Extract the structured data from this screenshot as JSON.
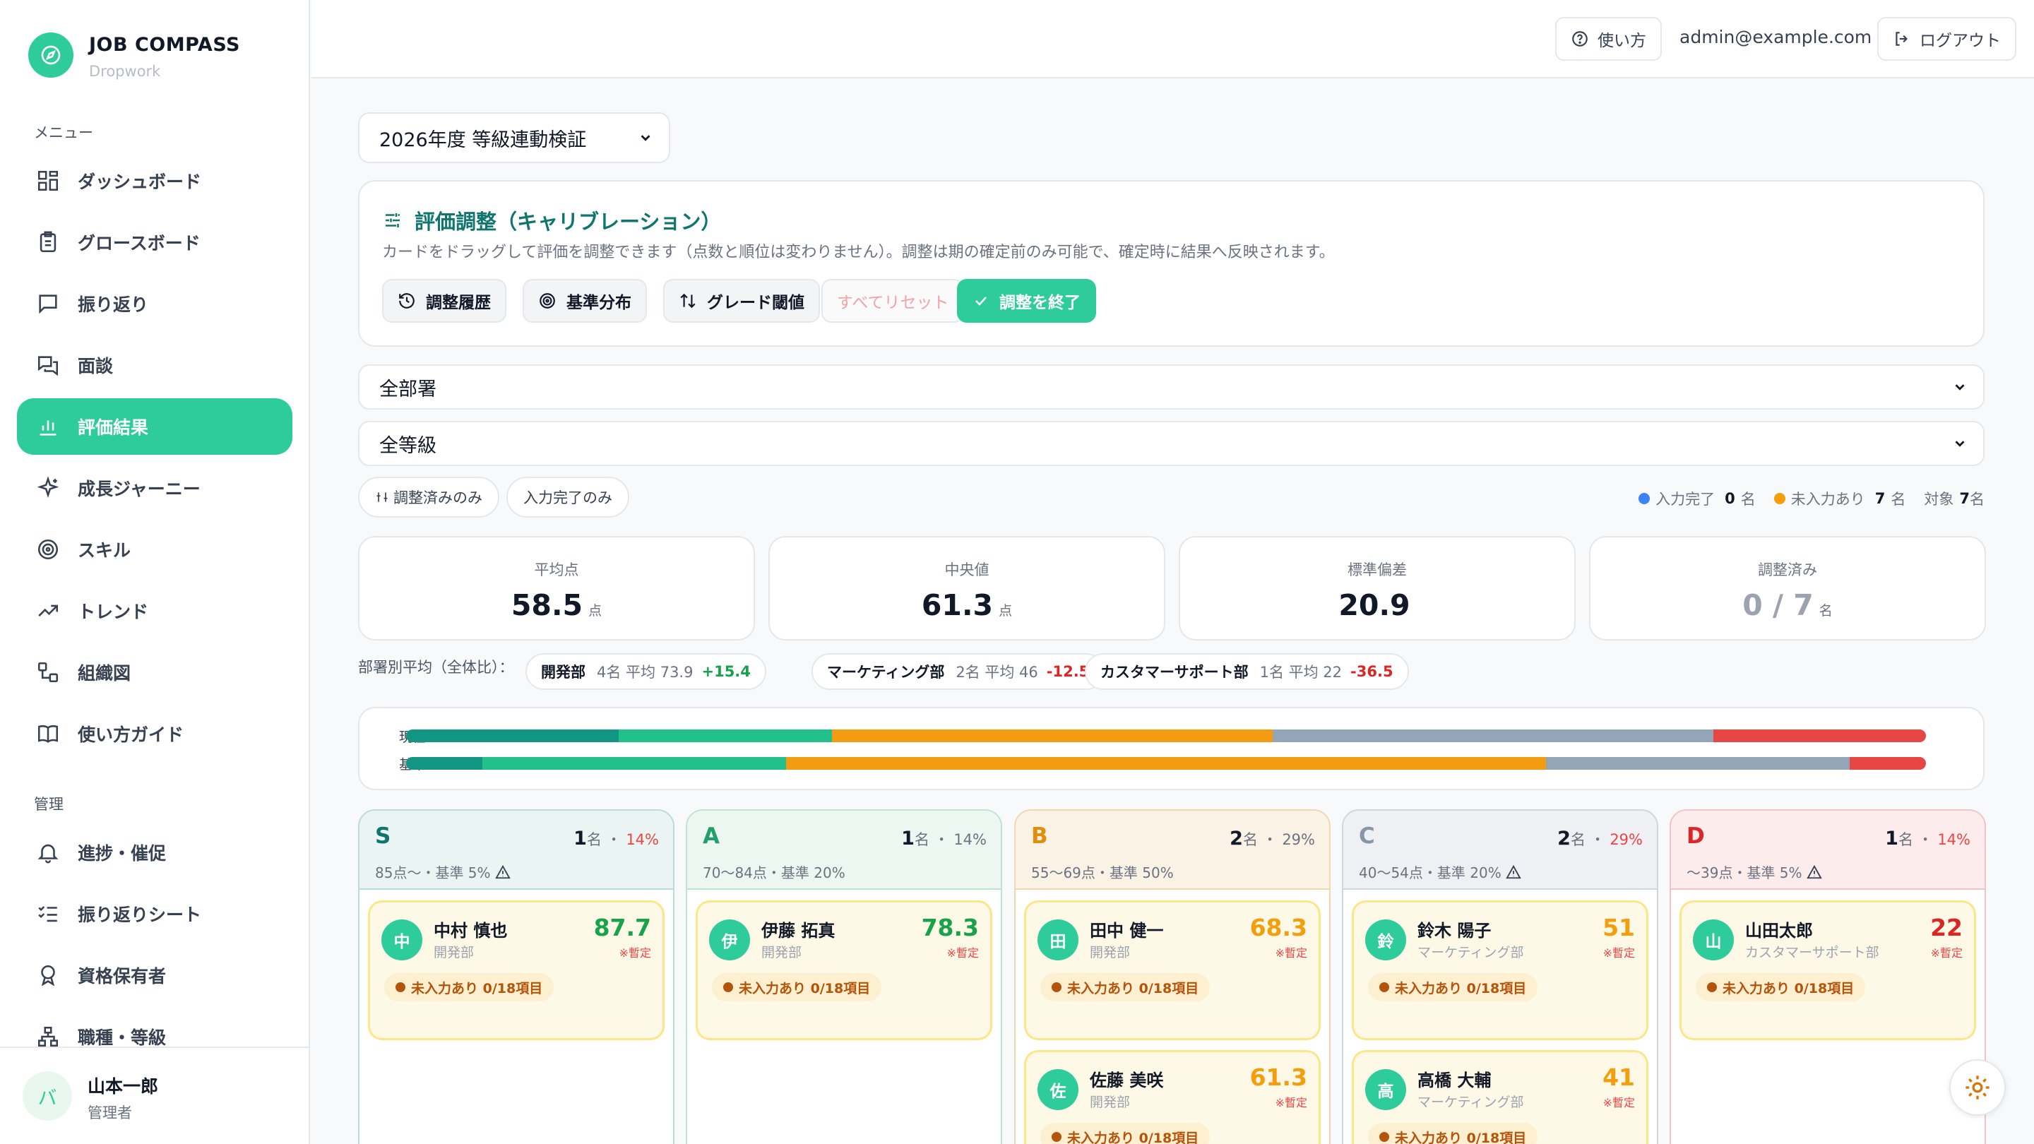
{
  "brand": {
    "title": "JOB COMPASS",
    "subtitle": "Dropwork"
  },
  "sidebar": {
    "menu_label": "メニュー",
    "admin_label": "管理",
    "items": [
      {
        "label": "ダッシュボード",
        "icon": "dashboard-icon"
      },
      {
        "label": "グロースボード",
        "icon": "clipboard-icon"
      },
      {
        "label": "振り返り",
        "icon": "message-icon"
      },
      {
        "label": "面談",
        "icon": "chat-icon"
      },
      {
        "label": "評価結果",
        "icon": "bar-chart-icon",
        "active": true
      },
      {
        "label": "成長ジャーニー",
        "icon": "sparkle-icon"
      },
      {
        "label": "スキル",
        "icon": "target-icon"
      },
      {
        "label": "トレンド",
        "icon": "trend-icon"
      },
      {
        "label": "組織図",
        "icon": "org-icon"
      },
      {
        "label": "使い方ガイド",
        "icon": "book-icon"
      }
    ],
    "admin_items": [
      {
        "label": "進捗・催促",
        "icon": "bell-icon"
      },
      {
        "label": "振り返りシート",
        "icon": "checklist-icon"
      },
      {
        "label": "資格保有者",
        "icon": "award-icon"
      },
      {
        "label": "職種・等級",
        "icon": "hierarchy-icon"
      }
    ],
    "user": {
      "initial": "バ",
      "name": "山本一郎",
      "role": "管理者"
    }
  },
  "header": {
    "help": "使い方",
    "email": "admin@example.com",
    "logout": "ログアウト"
  },
  "period_select": "2026年度 等級連動検証",
  "calibration": {
    "title": "評価調整（キャリブレーション）",
    "desc": "カードをドラッグして評価を調整できます（点数と順位は変わりません）。調整は期の確定前のみ可能で、確定時に結果へ反映されます。",
    "buttons": {
      "history": "調整履歴",
      "baseline": "基準分布",
      "threshold": "グレード閾値",
      "reset": "すべてリセット",
      "finish": "調整を終了"
    }
  },
  "filters": {
    "dept": "全部署",
    "grade": "全等級",
    "adjusted_only": "調整済みのみ",
    "complete_only": "入力完了のみ"
  },
  "legend": {
    "complete_label": "入力完了",
    "complete_count": "0",
    "incomplete_label": "未入力あり",
    "incomplete_count": "7",
    "unit": "名",
    "target_label": "対象",
    "target_count": "7"
  },
  "stats": [
    {
      "label": "平均点",
      "value": "58.5",
      "unit": "点"
    },
    {
      "label": "中央値",
      "value": "61.3",
      "unit": "点"
    },
    {
      "label": "標準偏差",
      "value": "20.9",
      "unit": ""
    },
    {
      "label": "調整済み",
      "value": "0 / 7",
      "unit": "名"
    }
  ],
  "dept_avg": {
    "label": "部署別平均（全体比）：",
    "items": [
      {
        "name": "開発部",
        "info": "4名 平均 73.9",
        "delta": "+15.4"
      },
      {
        "name": "マーケティング部",
        "info": "2名 平均 46",
        "delta": "-12.5"
      },
      {
        "name": "カスタマーサポート部",
        "info": "1名 平均 22",
        "delta": "-36.5"
      }
    ]
  },
  "distribution": {
    "current_label": "現在",
    "baseline_label": "基準",
    "current": [
      14,
      14,
      29,
      29,
      14
    ],
    "baseline": [
      5,
      20,
      50,
      20,
      5
    ],
    "colors": [
      "#129683",
      "#22c08a",
      "#f39c12",
      "#95a5b8",
      "#e84545"
    ]
  },
  "grades": [
    {
      "grade": "S",
      "count": "1",
      "pct": "14%",
      "pct_alert": true,
      "range": "85点〜・基準 5%",
      "warn": true,
      "employees": [
        {
          "initial": "中",
          "name": "中村 慎也",
          "dept": "開発部",
          "score": "87.7"
        }
      ]
    },
    {
      "grade": "A",
      "count": "1",
      "pct": "14%",
      "pct_alert": false,
      "range": "70〜84点・基準 20%",
      "warn": false,
      "employees": [
        {
          "initial": "伊",
          "name": "伊藤 拓真",
          "dept": "開発部",
          "score": "78.3"
        }
      ]
    },
    {
      "grade": "B",
      "count": "2",
      "pct": "29%",
      "pct_alert": false,
      "range": "55〜69点・基準 50%",
      "warn": false,
      "employees": [
        {
          "initial": "田",
          "name": "田中 健一",
          "dept": "開発部",
          "score": "68.3"
        },
        {
          "initial": "佐",
          "name": "佐藤 美咲",
          "dept": "開発部",
          "score": "61.3"
        }
      ]
    },
    {
      "grade": "C",
      "count": "2",
      "pct": "29%",
      "pct_alert": true,
      "range": "40〜54点・基準 20%",
      "warn": true,
      "employees": [
        {
          "initial": "鈴",
          "name": "鈴木 陽子",
          "dept": "マーケティング部",
          "score": "51"
        },
        {
          "initial": "高",
          "name": "高橋 大輔",
          "dept": "マーケティング部",
          "score": "41"
        }
      ]
    },
    {
      "grade": "D",
      "count": "1",
      "pct": "14%",
      "pct_alert": true,
      "range": "〜39点・基準 5%",
      "warn": true,
      "employees": [
        {
          "initial": "山",
          "name": "山田太郎",
          "dept": "カスタマーサポート部",
          "score": "22"
        }
      ]
    }
  ],
  "labels": {
    "count_unit": "名",
    "tentative": "※暫定",
    "badge": "未入力あり 0/18項目"
  }
}
